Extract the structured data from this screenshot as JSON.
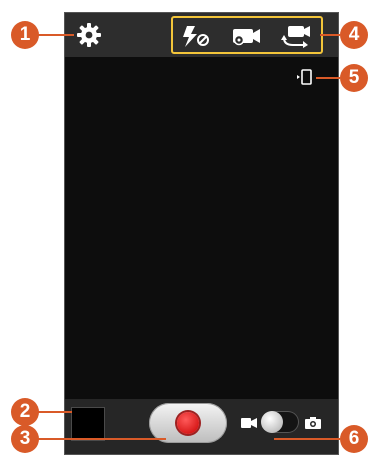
{
  "callouts": {
    "c1": "1",
    "c2": "2",
    "c3": "3",
    "c4": "4",
    "c5": "5",
    "c6": "6"
  },
  "colors": {
    "callout": "#d95a28",
    "highlight_border": "#f3c53a",
    "record": "#c80000",
    "viewfinder": "#0d0d0d"
  },
  "icons": {
    "settings": "gear-icon",
    "flash": "flash-off-icon",
    "mode": "recording-mode-icon",
    "switch_camera": "switch-camera-icon",
    "remote_indicator": "remote-viewfinder-icon",
    "record": "record-icon",
    "video_mode": "video-camera-icon",
    "photo_mode": "camera-icon"
  },
  "mode_switch": {
    "selected": "video"
  }
}
